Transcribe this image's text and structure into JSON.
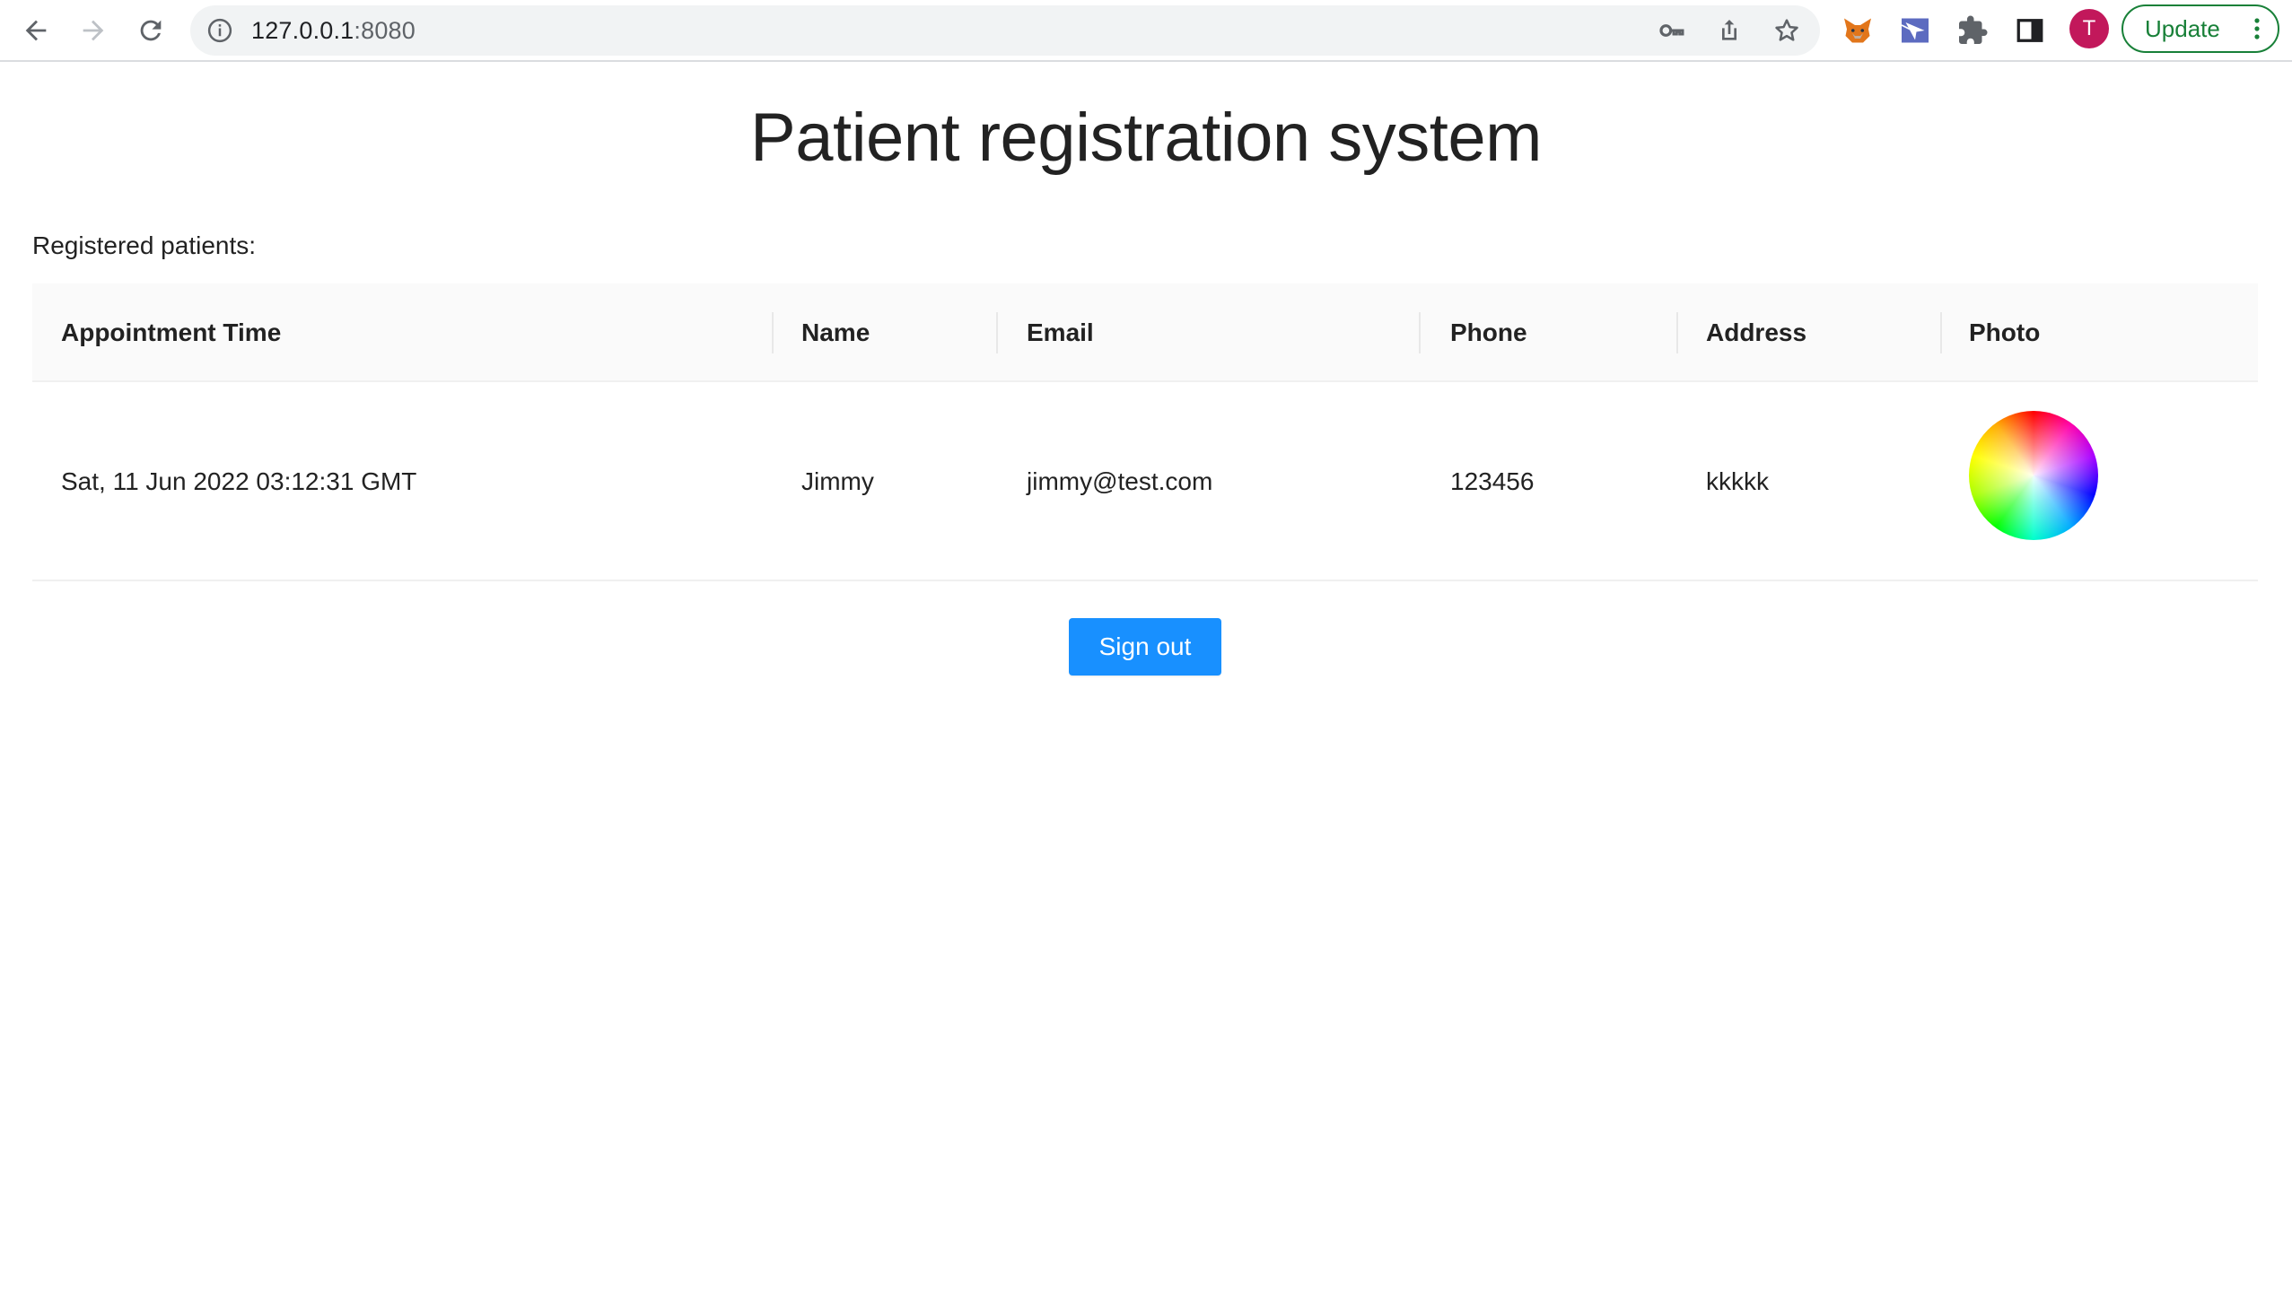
{
  "browser": {
    "url_host": "127.0.0.1",
    "url_port": ":8080",
    "avatar_initial": "T",
    "update_label": "Update",
    "icons": {
      "back": "arrow-left-icon",
      "forward": "arrow-right-icon",
      "reload": "reload-icon",
      "site_info": "info-icon",
      "key": "key-icon",
      "share": "share-icon",
      "bookmark": "star-icon",
      "metamask": "fox-icon",
      "extension2": "extension-icon",
      "extensions": "puzzle-icon",
      "side_panel": "side-panel-icon",
      "menu": "more-vert-icon"
    }
  },
  "page": {
    "title": "Patient registration system",
    "table_label": "Registered patients:",
    "columns": [
      "Appointment Time",
      "Name",
      "Email",
      "Phone",
      "Address",
      "Photo"
    ],
    "rows": [
      {
        "appointment_time": "Sat, 11 Jun 2022 03:12:31 GMT",
        "name": "Jimmy",
        "email": "jimmy@test.com",
        "phone": "123456",
        "address": "kkkkk",
        "photo": "color-wheel image"
      }
    ],
    "signout_label": "Sign out"
  },
  "colors": {
    "primary": "#1890ff",
    "update_green": "#188038",
    "avatar": "#c2185b",
    "header_bg": "#fafafa"
  }
}
